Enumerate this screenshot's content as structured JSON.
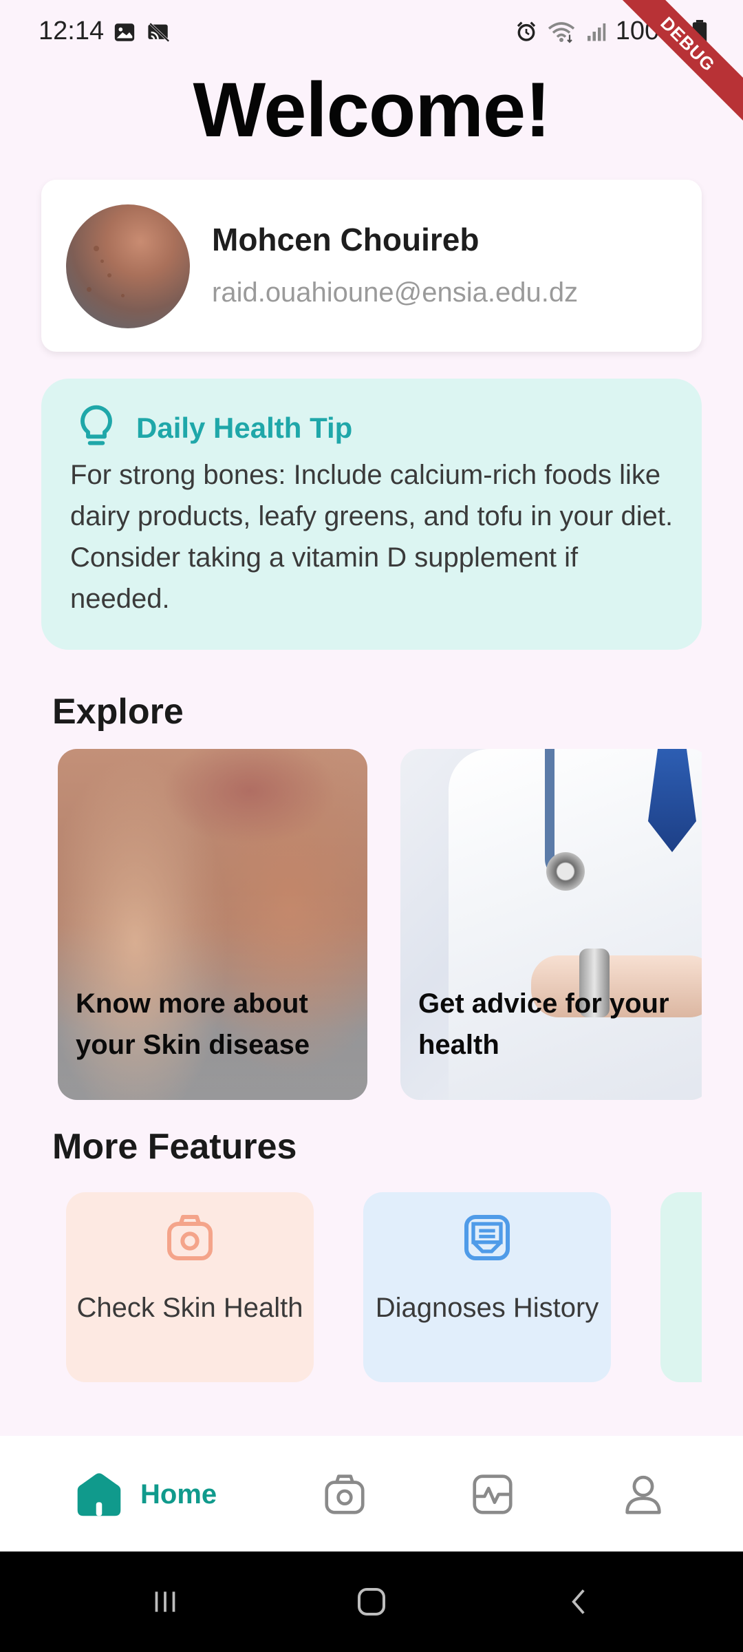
{
  "status_bar": {
    "time": "12:14",
    "battery": "100%",
    "debug_label": "DEBUG",
    "icons": [
      "image-icon",
      "cast-off-icon",
      "alarm-icon",
      "wifi-icon",
      "signal-icon",
      "battery-icon"
    ]
  },
  "welcome": "Welcome!",
  "profile": {
    "name": "Mohcen Chouireb",
    "email": "raid.ouahioune@ensia.edu.dz"
  },
  "tip": {
    "title": "Daily Health Tip",
    "body": "For strong bones: Include calcium-rich foods like dairy products, leafy greens, and tofu in your diet. Consider taking a vitamin D supplement if needed.",
    "accent_color": "#1fa7a9"
  },
  "explore": {
    "title": "Explore",
    "cards": [
      {
        "label": "Know more about your Skin disease"
      },
      {
        "label": "Get advice for your health"
      }
    ]
  },
  "features": {
    "title": "More Features",
    "items": [
      {
        "label": "Check Skin Health",
        "icon": "camera-icon",
        "color": "#f4a48a"
      },
      {
        "label": "Diagnoses History",
        "icon": "history-icon",
        "color": "#4f9be8"
      }
    ]
  },
  "bottom_nav": {
    "items": [
      {
        "label": "Home",
        "icon": "home-icon",
        "active": true
      },
      {
        "label": "",
        "icon": "camera-icon"
      },
      {
        "label": "",
        "icon": "health-activity-icon"
      },
      {
        "label": "",
        "icon": "profile-icon"
      }
    ],
    "active_color": "#109a8c"
  },
  "system_nav": [
    "recents-icon",
    "home-circle-icon",
    "back-icon"
  ]
}
